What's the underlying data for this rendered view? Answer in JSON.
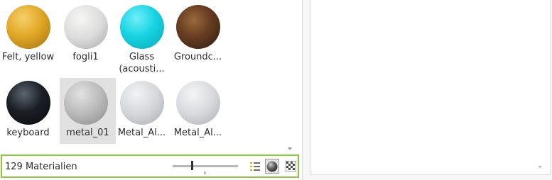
{
  "materials": [
    {
      "label": "Felt, yellow",
      "color": "#e1a826"
    },
    {
      "label": "fogli1",
      "color": "#dcdcdc"
    },
    {
      "label": "Glass (acousti...",
      "color": "#17d3e2"
    },
    {
      "label": "Groundc...",
      "color": "#6b3f22"
    },
    {
      "label": "keyboard",
      "color": "#1b1f25"
    },
    {
      "label": "metal_01",
      "color": "#b9b9b9"
    },
    {
      "label": "Metal_Al...",
      "color": "#d4d6da"
    },
    {
      "label": "Metal_Al...",
      "color": "#d7d9dc"
    }
  ],
  "selected_index": 5,
  "footer": {
    "count_text": "129 Materialien",
    "accent_color": "#8dc63f",
    "list_view_icon": "list-view-icon",
    "sphere_view_icon": "sphere-preview-icon",
    "checker_view_icon": "checker-background-icon"
  }
}
